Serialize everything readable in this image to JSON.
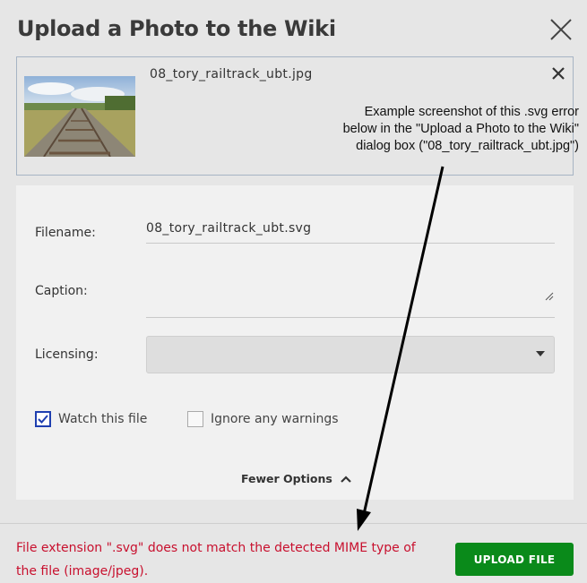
{
  "dialog": {
    "title": "Upload a Photo to the Wiki"
  },
  "file": {
    "name": "08_tory_railtrack_ubt.jpg",
    "thumbnail_icon": "railtrack-photo-thumbnail"
  },
  "annotation": {
    "lines": [
      "Example screenshot of this .svg error",
      "below in the \"Upload a Photo to the Wiki\"",
      "dialog box (\"08_tory_railtrack_ubt.jpg\")"
    ]
  },
  "form": {
    "filename_label": "Filename:",
    "filename_value": "08_tory_railtrack_ubt.svg",
    "caption_label": "Caption:",
    "caption_value": "",
    "licensing_label": "Licensing:",
    "licensing_value": "",
    "watch_label": "Watch this file",
    "watch_checked": true,
    "ignore_label": "Ignore any warnings",
    "ignore_checked": false,
    "fewer_options_label": "Fewer Options"
  },
  "footer": {
    "error": "File extension \".svg\" does not match the detected MIME type of the file (image/jpeg).",
    "upload_label": "UPLOAD FILE"
  },
  "colors": {
    "accent": "#1f3fb0",
    "error": "#c8102e",
    "upload_button": "#0a8a1a"
  }
}
